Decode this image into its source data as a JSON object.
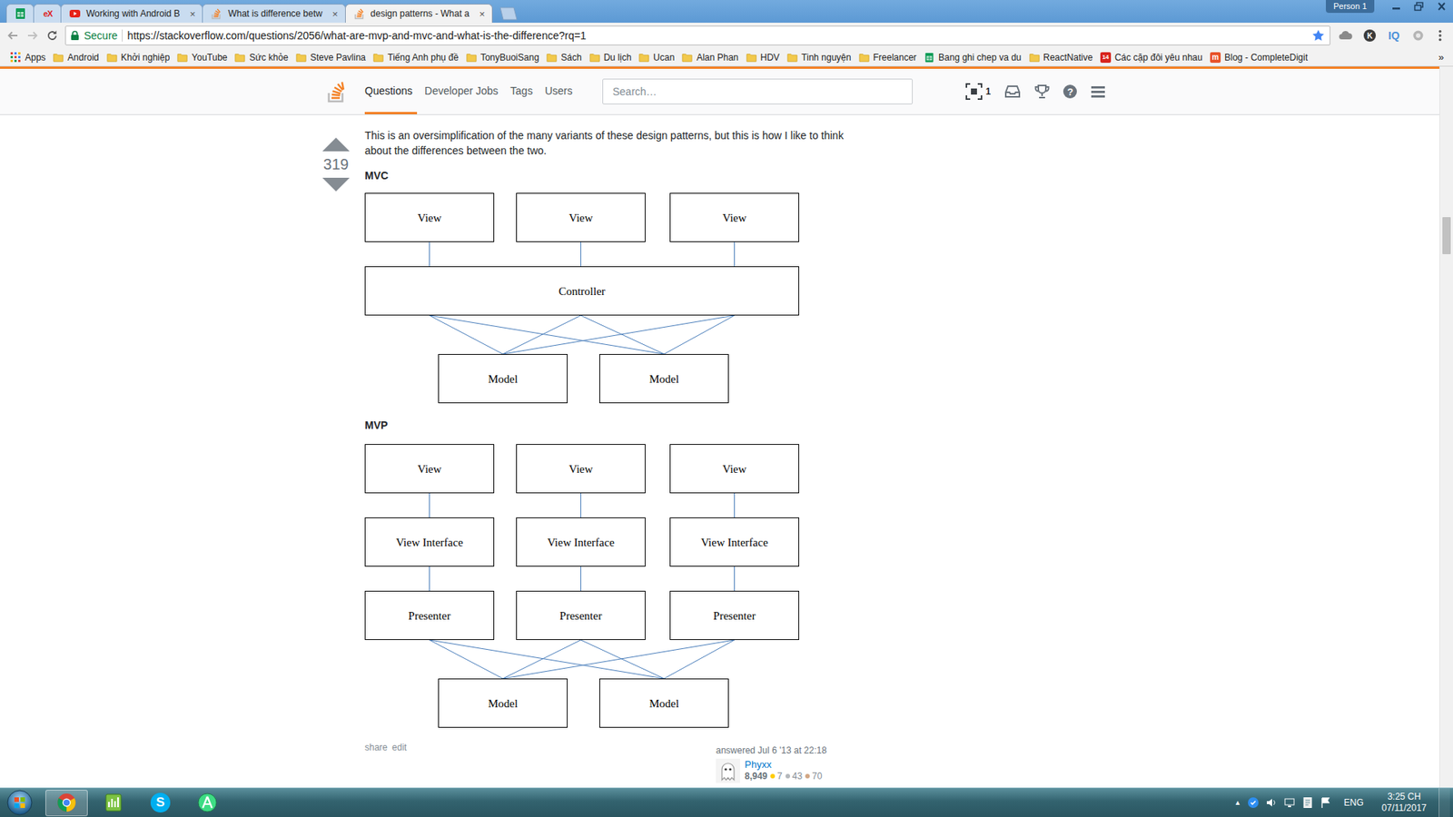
{
  "browser": {
    "tabs": [
      {
        "kind": "sheets",
        "selected": false
      },
      {
        "kind": "edx",
        "icon_text": "eX",
        "selected": false
      },
      {
        "kind": "youtube",
        "label": "Working with Android B",
        "close": "×",
        "selected": false
      },
      {
        "kind": "stackoverflow",
        "label": "What is difference betw",
        "close": "×",
        "selected": false
      },
      {
        "kind": "stackoverflow",
        "label": "design patterns - What a",
        "close": "×",
        "selected": true
      }
    ],
    "profile": "Person 1",
    "toolbar": {
      "secure": "Secure",
      "url": "https://stackoverflow.com/questions/2056/what-are-mvp-and-mvc-and-what-is-the-difference?rq=1",
      "bookmarked": true,
      "extensions": [
        {
          "kind": "cloud"
        },
        {
          "kind": "letter",
          "text": "K"
        },
        {
          "kind": "label",
          "text": "IQ"
        },
        {
          "kind": "puzzle"
        }
      ]
    },
    "bookmarks": {
      "apps": "Apps",
      "more": "»",
      "items": [
        {
          "label": "Android",
          "kind": "folder"
        },
        {
          "label": "Khởi nghiệp",
          "kind": "folder"
        },
        {
          "label": "YouTube",
          "kind": "folder"
        },
        {
          "label": "Sức khỏe",
          "kind": "folder"
        },
        {
          "label": "Steve Pavlina",
          "kind": "folder"
        },
        {
          "label": "Tiếng Anh phụ đề",
          "kind": "folder"
        },
        {
          "label": "TonyBuoiSang",
          "kind": "folder"
        },
        {
          "label": "Sách",
          "kind": "folder"
        },
        {
          "label": "Du lịch",
          "kind": "folder"
        },
        {
          "label": "Ucan",
          "kind": "folder"
        },
        {
          "label": "Alan Phan",
          "kind": "folder"
        },
        {
          "label": "HDV",
          "kind": "folder"
        },
        {
          "label": "Tinh nguyện",
          "kind": "folder"
        },
        {
          "label": "Freelancer",
          "kind": "folder"
        },
        {
          "label": "Bang ghi chep va du",
          "kind": "sheet"
        },
        {
          "label": "ReactNative",
          "kind": "folder"
        },
        {
          "label": "Các cặp đôi yêu nhau",
          "kind": "news",
          "icon_text": "14"
        },
        {
          "label": "Blog - CompleteDigit",
          "kind": "blog",
          "icon_text": "m"
        }
      ]
    }
  },
  "site": {
    "nav": [
      {
        "label": "Questions",
        "selected": true
      },
      {
        "label": "Developer Jobs",
        "selected": false
      },
      {
        "label": "Tags",
        "selected": false
      },
      {
        "label": "Users",
        "selected": false
      }
    ],
    "search": {
      "placeholder": "Search…"
    },
    "achievements": "1",
    "help": "?"
  },
  "post": {
    "votes": "319",
    "text": "This is an oversimplification of the many variants of these design patterns, but this is how I like to think about the differences between the two.",
    "diagrams": [
      {
        "title": "MVC",
        "rows": [
          [
            "View",
            "View",
            "View"
          ],
          [
            "Controller"
          ],
          [
            "Model",
            "Model"
          ]
        ]
      },
      {
        "title": "MVP",
        "rows": [
          [
            "View",
            "View",
            "View"
          ],
          [
            "View Interface",
            "View Interface",
            "View Interface"
          ],
          [
            "Presenter",
            "Presenter",
            "Presenter"
          ],
          [
            "Model",
            "Model"
          ]
        ]
      }
    ],
    "actions": [
      "share",
      "edit"
    ],
    "signature": {
      "action": "answered Jul 6 '13 at 22:18",
      "user": "Phyxx",
      "reputation": "8,949",
      "badges": [
        {
          "count": "7",
          "color": "#ffcc01"
        },
        {
          "count": "43",
          "color": "#b4b8bc"
        },
        {
          "count": "70",
          "color": "#d1a684"
        }
      ]
    }
  },
  "scrollbar": {
    "position": 0.22
  },
  "taskbar": {
    "apps": [
      {
        "kind": "chrome",
        "active": true
      },
      {
        "kind": "notepad",
        "active": false
      },
      {
        "kind": "skype",
        "icon_text": "S",
        "active": false
      },
      {
        "kind": "android-studio",
        "active": false
      }
    ],
    "tray": {
      "overflow": "▲",
      "language": "ENG",
      "time": "3:25 CH",
      "date": "07/11/2017"
    }
  }
}
